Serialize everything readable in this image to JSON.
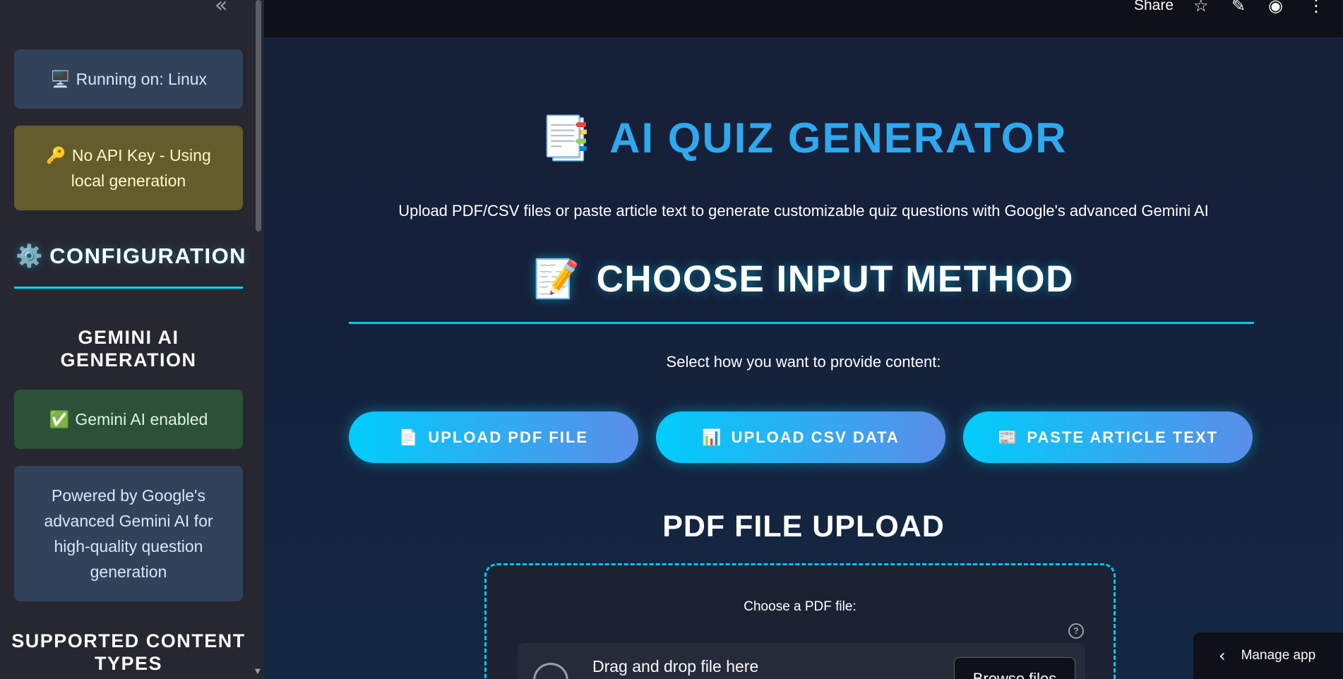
{
  "sidebar": {
    "collapse_icon": "«",
    "running": {
      "icon": "🖥️",
      "text": "Running on: Linux"
    },
    "api_key": {
      "icon": "🔑",
      "text": "No API Key - Using local generation"
    },
    "config": {
      "icon": "⚙️",
      "title": "CONFIGURATION"
    },
    "gen_title": "GEMINI AI GENERATION",
    "gemini_enabled": {
      "icon": "✅",
      "text": "Gemini AI enabled"
    },
    "powered": "Powered by Google's advanced Gemini AI for high-quality question generation",
    "types_title": "SUPPORTED CONTENT TYPES"
  },
  "toolbar": {
    "share": "Share",
    "star_icon": "☆",
    "edit_icon": "✎",
    "github_icon": "◉",
    "more_icon": "⋮"
  },
  "header": {
    "title_icon": "📑",
    "title": "AI QUIZ GENERATOR",
    "subtitle": "Upload PDF/CSV files or paste article text to generate customizable quiz questions with Google's advanced Gemini AI"
  },
  "method": {
    "icon": "📝",
    "title": "CHOOSE INPUT METHOD",
    "prompt": "Select how you want to provide content:",
    "buttons": [
      {
        "icon": "📄",
        "label": "UPLOAD PDF FILE"
      },
      {
        "icon": "📊",
        "label": "UPLOAD CSV DATA"
      },
      {
        "icon": "📰",
        "label": "PASTE ARTICLE TEXT"
      }
    ]
  },
  "upload": {
    "title": "PDF FILE UPLOAD",
    "label": "Choose a PDF file:",
    "help_icon": "?",
    "drag_text": "Drag and drop file here",
    "browse": "Browse files"
  },
  "manage": {
    "chevron": "‹",
    "label": "Manage app"
  }
}
